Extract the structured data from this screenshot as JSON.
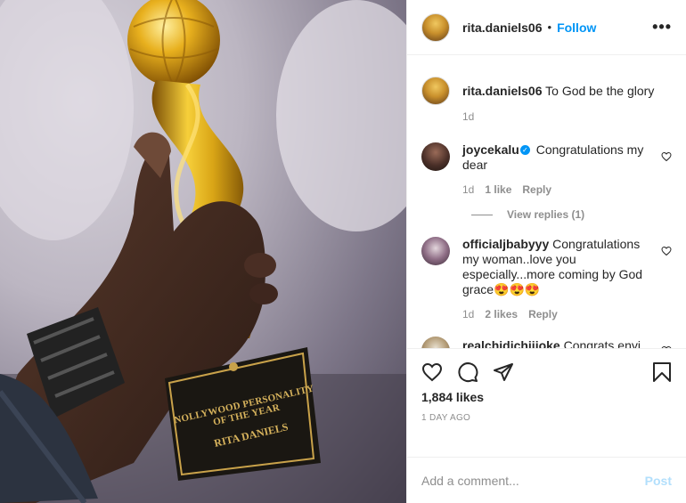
{
  "photo": {
    "plaque_line1": "NOLLYWOOD PERSONALITY",
    "plaque_line2": "OF THE YEAR",
    "plaque_name": "RITA DANIELS"
  },
  "header": {
    "username": "rita.daniels06",
    "separator": "•",
    "follow_label": "Follow",
    "more_icon": "ellipsis-icon",
    "more_label": "•••"
  },
  "caption": {
    "username": "rita.daniels06",
    "text": "To God be the glory",
    "time": "1d"
  },
  "comments": [
    {
      "username": "joycekalu",
      "verified": true,
      "text": "Congratulations my dear",
      "time": "1d",
      "likes": "1 like",
      "reply": "Reply",
      "view_replies": "View replies (1)"
    },
    {
      "username": "officialjbabyyy",
      "text": "Congratulations my woman..love you especially...more coming by God grace😍😍😍",
      "time": "1d",
      "likes": "2 likes",
      "reply": "Reply"
    },
    {
      "username": "realchidichijioke",
      "text": "Congrats enyi"
    }
  ],
  "actions": {
    "like_icon": "heart-icon",
    "comment_icon": "comment-icon",
    "share_icon": "share-icon",
    "save_icon": "bookmark-icon",
    "likes_count": "1,884 likes",
    "posted_ago": "1 DAY AGO"
  },
  "add_comment": {
    "placeholder": "Add a comment...",
    "post_label": "Post"
  },
  "colors": {
    "accent": "#0095f6",
    "post_disabled": "#b2dffc",
    "muted": "#8e8e8e"
  }
}
